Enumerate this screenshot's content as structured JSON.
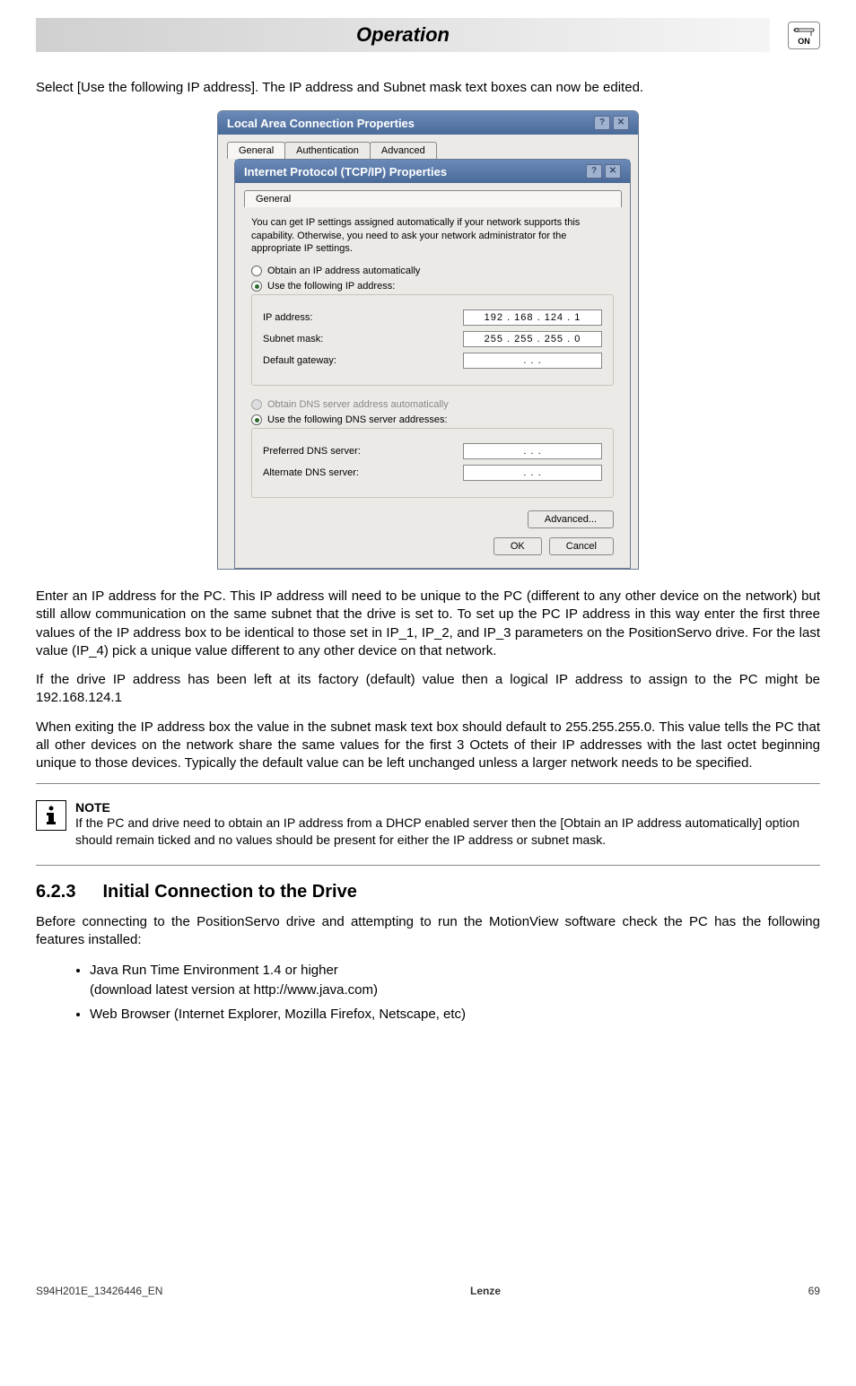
{
  "header": {
    "title": "Operation",
    "power_label": "ON"
  },
  "intro": "Select [Use the following IP address]. The IP address and Subnet mask text boxes can now be edited.",
  "outer_dialog": {
    "title": "Local Area Connection Properties",
    "tabs": [
      "General",
      "Authentication",
      "Advanced"
    ]
  },
  "inner_dialog": {
    "title": "Internet Protocol (TCP/IP) Properties",
    "tab": "General",
    "desc": "You can get IP settings assigned automatically if your network supports this capability. Otherwise, you need to ask your network administrator for the appropriate IP settings.",
    "opt_auto_ip": "Obtain an IP address automatically",
    "opt_use_ip": "Use the following IP address:",
    "ip_label": "IP address:",
    "ip_value": "192 . 168 . 124 .   1",
    "subnet_label": "Subnet mask:",
    "subnet_value": "255 . 255 . 255 .   0",
    "gateway_label": "Default gateway:",
    "gateway_value": ".       .       .",
    "opt_auto_dns": "Obtain DNS server address automatically",
    "opt_use_dns": "Use the following DNS server addresses:",
    "pref_dns_label": "Preferred DNS server:",
    "pref_dns_value": ".       .       .",
    "alt_dns_label": "Alternate DNS server:",
    "alt_dns_value": ".       .       .",
    "advanced_btn": "Advanced...",
    "ok_btn": "OK",
    "cancel_btn": "Cancel"
  },
  "para1": "Enter an IP address for the PC. This IP address will need to be unique to the PC (different to any other device on the network) but still allow communication on the same subnet that the drive is set to. To set up the PC IP address in this way enter the first three values of the IP address box to be identical to those set in IP_1, IP_2, and IP_3 parameters on the PositionServo drive. For the last value (IP_4) pick a unique value different to any other device on that network.",
  "para2": "If the drive IP address has been left at its factory (default) value then a logical IP address to assign to the PC might be 192.168.124.1",
  "para3": "When exiting the IP address box the value in the subnet mask text box should default to 255.255.255.0. This value tells the PC that all other devices on the network share the same values for the first 3 Octets of their IP addresses with the last octet beginning unique to those devices. Typically the default value can be left unchanged unless a larger network needs to be specified.",
  "note": {
    "title": "NOTE",
    "text": "If the PC and drive need to obtain an IP address from a DHCP enabled server then the [Obtain an IP address automatically] option should remain ticked and no values should be present for either the IP address or subnet mask."
  },
  "section": {
    "num": "6.2.3",
    "title": "Initial Connection to the Drive"
  },
  "para4": "Before connecting to the PositionServo drive and attempting to run the MotionView software check the PC has the following features installed:",
  "bullets": [
    "Java Run Time Environment 1.4 or higher",
    "(download latest version at http://www.java.com)",
    "Web Browser (Internet Explorer, Mozilla Firefox, Netscape, etc)"
  ],
  "footer": {
    "left": "S94H201E_13426446_EN",
    "center": "Lenze",
    "right": "69"
  }
}
